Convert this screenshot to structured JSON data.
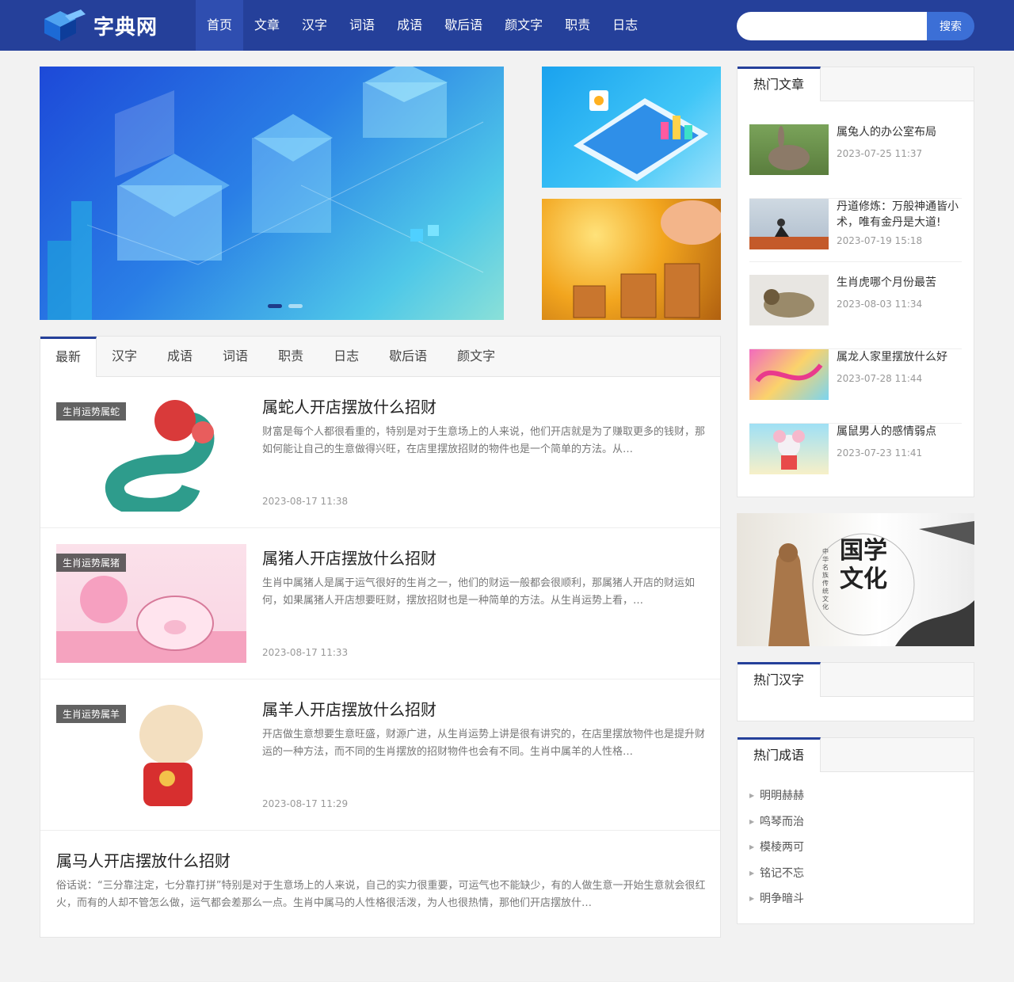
{
  "site": {
    "logo_text": "字典网"
  },
  "nav": [
    {
      "label": "首页",
      "active": true
    },
    {
      "label": "文章"
    },
    {
      "label": "汉字"
    },
    {
      "label": "词语"
    },
    {
      "label": "成语"
    },
    {
      "label": "歇后语"
    },
    {
      "label": "颜文字"
    },
    {
      "label": "职责"
    },
    {
      "label": "日志"
    }
  ],
  "search": {
    "value": "",
    "placeholder": "",
    "button": "搜索"
  },
  "carousel": {
    "slides": 2,
    "active": 1
  },
  "tabs": [
    "最新",
    "汉字",
    "成语",
    "词语",
    "职责",
    "日志",
    "歇后语",
    "颜文字"
  ],
  "articles": [
    {
      "tag": "生肖运势属蛇",
      "title": "属蛇人开店摆放什么招财",
      "desc": "财富是每个人都很看重的，特别是对于生意场上的人来说，他们开店就是为了赚取更多的钱财，那如何能让自己的生意做得兴旺，在店里摆放招财的物件也是一个简单的方法。从…",
      "date": "2023-08-17 11:38"
    },
    {
      "tag": "生肖运势属猪",
      "title": "属猪人开店摆放什么招财",
      "desc": "生肖中属猪人是属于运气很好的生肖之一，他们的财运一般都会很顺利，那属猪人开店的财运如何，如果属猪人开店想要旺财，摆放招财也是一种简单的方法。从生肖运势上看，…",
      "date": "2023-08-17 11:33"
    },
    {
      "tag": "生肖运势属羊",
      "title": "属羊人开店摆放什么招财",
      "desc": "开店做生意想要生意旺盛，财源广进，从生肖运势上讲是很有讲究的，在店里摆放物件也是提升财运的一种方法，而不同的生肖摆放的招财物件也会有不同。生肖中属羊的人性格…",
      "date": "2023-08-17 11:29"
    },
    {
      "title": "属马人开店摆放什么招财",
      "desc": "俗话说：“三分靠注定，七分靠打拼”特别是对于生意场上的人来说，自己的实力很重要，可运气也不能缺少，有的人做生意一开始生意就会很红火，而有的人却不管怎么做，运气都会差那么一点。生肖中属马的人性格很活泼，为人也很热情，那他们开店摆放什…"
    }
  ],
  "sidebar": {
    "hot_articles_title": "热门文章",
    "hot_articles": [
      {
        "title": "属兔人的办公室布局",
        "date": "2023-07-25 11:37"
      },
      {
        "title": "丹道修炼：万般神通皆小术，唯有金丹是大道!",
        "date": "2023-07-19 15:18"
      },
      {
        "title": "生肖虎哪个月份最苦",
        "date": "2023-08-03 11:34"
      },
      {
        "title": "属龙人家里摆放什么好",
        "date": "2023-07-28 11:44"
      },
      {
        "title": "属鼠男人的感情弱点",
        "date": "2023-07-23 11:41"
      }
    ],
    "guoxue_banner": {
      "big": "国学文化",
      "small": "中华名族传统文化"
    },
    "hot_chars_title": "热门汉字",
    "hot_idioms_title": "热门成语",
    "hot_idioms": [
      "明明赫赫",
      "鸣琴而治",
      "模棱两可",
      "铭记不忘",
      "明争暗斗"
    ]
  },
  "colors": {
    "header": "#25409a",
    "accent": "#3c6fd6",
    "nav_active": "#2f4eb0"
  }
}
